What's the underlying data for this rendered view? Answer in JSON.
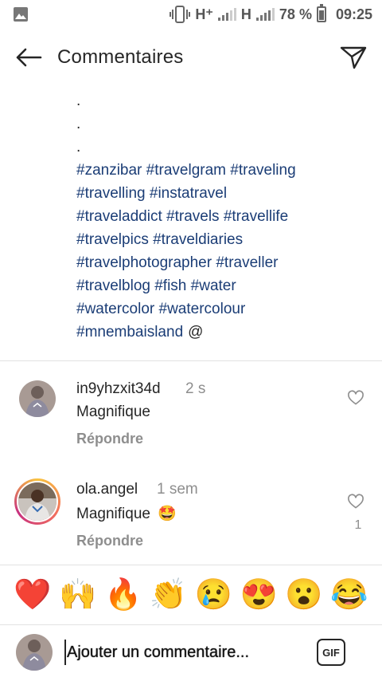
{
  "status_bar": {
    "network1": "H⁺",
    "network2": "H",
    "battery": "78 %",
    "time": "09:25"
  },
  "header": {
    "title": "Commentaires",
    "back_icon": "arrow-left-icon",
    "send_icon": "paper-plane-icon"
  },
  "caption": {
    "dots": [
      ".",
      ".",
      "."
    ],
    "hashtag_lines": [
      [
        "#zanzibar",
        "#travelgram",
        "#traveling"
      ],
      [
        "#travelling",
        "#instatravel"
      ],
      [
        "#traveladdict",
        "#travels",
        "#travellife"
      ],
      [
        "#travelpics",
        "#traveldiaries"
      ],
      [
        "#travelphotographer",
        "#traveller"
      ],
      [
        "#travelblog",
        "#fish",
        "#water"
      ],
      [
        "#watercolor",
        "#watercolour"
      ],
      [
        "#mnembaisland"
      ]
    ],
    "mention": "@"
  },
  "comments": [
    {
      "username": "in9yhzxit34d",
      "time": "2 s",
      "text": "Magnifique",
      "reply": "Répondre",
      "likes": ""
    },
    {
      "username": "ola.angel",
      "time": "1 sem",
      "text": "Magnifique",
      "emoji": "🤩",
      "reply": "Répondre",
      "likes": "1"
    }
  ],
  "emoji_bar": [
    "❤️",
    "🙌",
    "🔥",
    "👏",
    "😢",
    "😍",
    "😮",
    "😂"
  ],
  "input": {
    "placeholder": "Ajouter un commentaire...",
    "gif_label": "GIF"
  },
  "colors": {
    "hashtag": "#1b3d76",
    "secondary_text": "#8e8e8e"
  }
}
